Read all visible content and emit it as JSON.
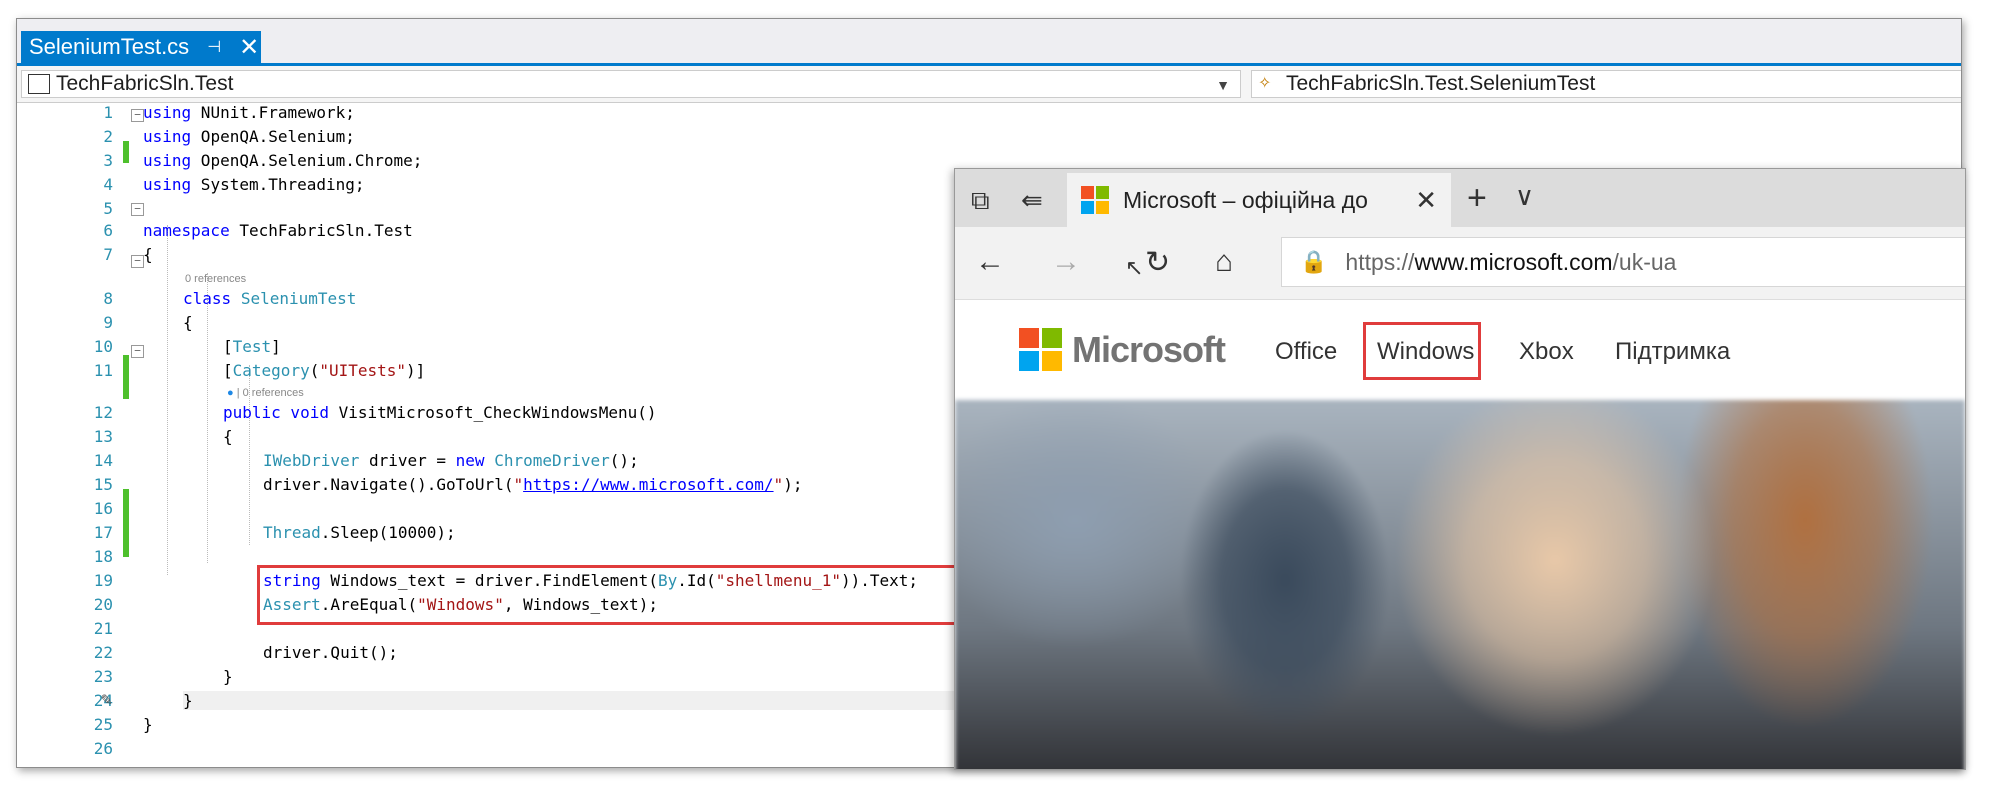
{
  "editor_tab": {
    "title": "SeleniumTest.cs",
    "pin": "⊣",
    "close": "✕"
  },
  "nav": {
    "project": "TechFabricSln.Test",
    "class": "TechFabricSln.Test.SeleniumTest"
  },
  "code": {
    "lines": [
      "1",
      "2",
      "3",
      "4",
      "5",
      "6",
      "7",
      "8",
      "9",
      "10",
      "11",
      "12",
      "13",
      "14",
      "15",
      "16",
      "17",
      "18",
      "19",
      "20",
      "21",
      "22",
      "23",
      "24",
      "25",
      "26"
    ],
    "l1_kw": "using",
    "l1_rest": " NUnit.Framework;",
    "l2_kw": "using",
    "l2_rest": " OpenQA.Selenium;",
    "l3_kw": "using",
    "l3_rest": " OpenQA.Selenium.Chrome;",
    "l4_kw": "using",
    "l4_rest": " System.Threading;",
    "l6_kw": "namespace",
    "l6_rest": " TechFabricSln.Test",
    "l7": "{",
    "refs1": "0 references",
    "l8_kw": "class",
    "l8_ty": "SeleniumTest",
    "l9": "{",
    "l10_a": "[",
    "l10_ty": "Test",
    "l10_b": "]",
    "l11_a": "[",
    "l11_ty": "Category",
    "l11_b": "(",
    "l11_str": "\"UITests\"",
    "l11_c": ")]",
    "refs2": "| 0 references",
    "l12_kw": "public void",
    "l12_rest": " VisitMicrosoft_CheckWindowsMenu()",
    "l13": "{",
    "l14_ty": "IWebDriver",
    "l14_a": " driver = ",
    "l14_kw": "new",
    "l14_ty2": "ChromeDriver",
    "l14_b": "();",
    "l15_a": "driver.Navigate().GoToUrl(",
    "l15_q1": "\"",
    "l15_link": "https://www.microsoft.com/",
    "l15_q2": "\"",
    "l15_b": ");",
    "l17_ty": "Thread",
    "l17_rest": ".Sleep(10000);",
    "l19_kw": "string",
    "l19_a": " Windows_text = driver.FindElement(",
    "l19_ty": "By",
    "l19_b": ".Id(",
    "l19_str": "\"shellmenu_1\"",
    "l19_c": ")).Text;",
    "l20_ty": "Assert",
    "l20_a": ".AreEqual(",
    "l20_str": "\"Windows\"",
    "l20_b": ", Windows_text);",
    "l22": "driver.Quit();",
    "l23": "}",
    "l24": "}",
    "l25": "}"
  },
  "browser": {
    "tab_title": "Microsoft – офіційна до",
    "tab_close": "✕",
    "new_tab": "+",
    "tab_menu": "∨",
    "url_base": "https://",
    "url_domain": "www.microsoft.com",
    "url_path": "/uk-ua",
    "brand": "Microsoft",
    "menu": [
      "Office",
      "Windows",
      "Xbox",
      "Підтримка"
    ]
  },
  "colors": {
    "ms_red": "#f25022",
    "ms_green": "#7fba00",
    "ms_blue": "#00a4ef",
    "ms_yellow": "#ffb900",
    "highlight": "#e03c3c",
    "vs_blue": "#007acc"
  }
}
